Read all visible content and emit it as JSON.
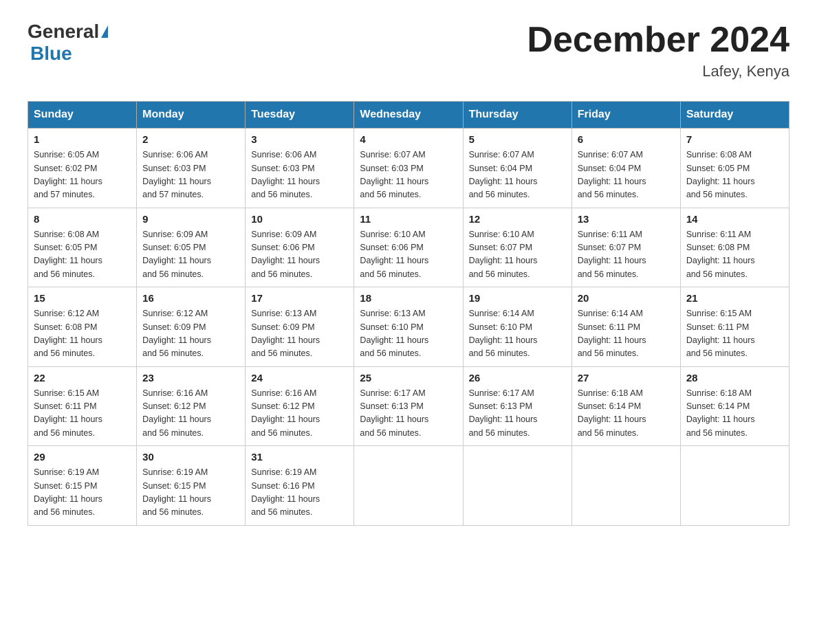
{
  "header": {
    "logo": {
      "general": "General",
      "blue": "Blue"
    },
    "title": "December 2024",
    "location": "Lafey, Kenya"
  },
  "weekdays": [
    "Sunday",
    "Monday",
    "Tuesday",
    "Wednesday",
    "Thursday",
    "Friday",
    "Saturday"
  ],
  "weeks": [
    [
      {
        "day": "1",
        "sunrise": "6:05 AM",
        "sunset": "6:02 PM",
        "daylight": "11 hours and 57 minutes."
      },
      {
        "day": "2",
        "sunrise": "6:06 AM",
        "sunset": "6:03 PM",
        "daylight": "11 hours and 57 minutes."
      },
      {
        "day": "3",
        "sunrise": "6:06 AM",
        "sunset": "6:03 PM",
        "daylight": "11 hours and 56 minutes."
      },
      {
        "day": "4",
        "sunrise": "6:07 AM",
        "sunset": "6:03 PM",
        "daylight": "11 hours and 56 minutes."
      },
      {
        "day": "5",
        "sunrise": "6:07 AM",
        "sunset": "6:04 PM",
        "daylight": "11 hours and 56 minutes."
      },
      {
        "day": "6",
        "sunrise": "6:07 AM",
        "sunset": "6:04 PM",
        "daylight": "11 hours and 56 minutes."
      },
      {
        "day": "7",
        "sunrise": "6:08 AM",
        "sunset": "6:05 PM",
        "daylight": "11 hours and 56 minutes."
      }
    ],
    [
      {
        "day": "8",
        "sunrise": "6:08 AM",
        "sunset": "6:05 PM",
        "daylight": "11 hours and 56 minutes."
      },
      {
        "day": "9",
        "sunrise": "6:09 AM",
        "sunset": "6:05 PM",
        "daylight": "11 hours and 56 minutes."
      },
      {
        "day": "10",
        "sunrise": "6:09 AM",
        "sunset": "6:06 PM",
        "daylight": "11 hours and 56 minutes."
      },
      {
        "day": "11",
        "sunrise": "6:10 AM",
        "sunset": "6:06 PM",
        "daylight": "11 hours and 56 minutes."
      },
      {
        "day": "12",
        "sunrise": "6:10 AM",
        "sunset": "6:07 PM",
        "daylight": "11 hours and 56 minutes."
      },
      {
        "day": "13",
        "sunrise": "6:11 AM",
        "sunset": "6:07 PM",
        "daylight": "11 hours and 56 minutes."
      },
      {
        "day": "14",
        "sunrise": "6:11 AM",
        "sunset": "6:08 PM",
        "daylight": "11 hours and 56 minutes."
      }
    ],
    [
      {
        "day": "15",
        "sunrise": "6:12 AM",
        "sunset": "6:08 PM",
        "daylight": "11 hours and 56 minutes."
      },
      {
        "day": "16",
        "sunrise": "6:12 AM",
        "sunset": "6:09 PM",
        "daylight": "11 hours and 56 minutes."
      },
      {
        "day": "17",
        "sunrise": "6:13 AM",
        "sunset": "6:09 PM",
        "daylight": "11 hours and 56 minutes."
      },
      {
        "day": "18",
        "sunrise": "6:13 AM",
        "sunset": "6:10 PM",
        "daylight": "11 hours and 56 minutes."
      },
      {
        "day": "19",
        "sunrise": "6:14 AM",
        "sunset": "6:10 PM",
        "daylight": "11 hours and 56 minutes."
      },
      {
        "day": "20",
        "sunrise": "6:14 AM",
        "sunset": "6:11 PM",
        "daylight": "11 hours and 56 minutes."
      },
      {
        "day": "21",
        "sunrise": "6:15 AM",
        "sunset": "6:11 PM",
        "daylight": "11 hours and 56 minutes."
      }
    ],
    [
      {
        "day": "22",
        "sunrise": "6:15 AM",
        "sunset": "6:11 PM",
        "daylight": "11 hours and 56 minutes."
      },
      {
        "day": "23",
        "sunrise": "6:16 AM",
        "sunset": "6:12 PM",
        "daylight": "11 hours and 56 minutes."
      },
      {
        "day": "24",
        "sunrise": "6:16 AM",
        "sunset": "6:12 PM",
        "daylight": "11 hours and 56 minutes."
      },
      {
        "day": "25",
        "sunrise": "6:17 AM",
        "sunset": "6:13 PM",
        "daylight": "11 hours and 56 minutes."
      },
      {
        "day": "26",
        "sunrise": "6:17 AM",
        "sunset": "6:13 PM",
        "daylight": "11 hours and 56 minutes."
      },
      {
        "day": "27",
        "sunrise": "6:18 AM",
        "sunset": "6:14 PM",
        "daylight": "11 hours and 56 minutes."
      },
      {
        "day": "28",
        "sunrise": "6:18 AM",
        "sunset": "6:14 PM",
        "daylight": "11 hours and 56 minutes."
      }
    ],
    [
      {
        "day": "29",
        "sunrise": "6:19 AM",
        "sunset": "6:15 PM",
        "daylight": "11 hours and 56 minutes."
      },
      {
        "day": "30",
        "sunrise": "6:19 AM",
        "sunset": "6:15 PM",
        "daylight": "11 hours and 56 minutes."
      },
      {
        "day": "31",
        "sunrise": "6:19 AM",
        "sunset": "6:16 PM",
        "daylight": "11 hours and 56 minutes."
      },
      null,
      null,
      null,
      null
    ]
  ],
  "labels": {
    "sunrise": "Sunrise:",
    "sunset": "Sunset:",
    "daylight": "Daylight:"
  }
}
